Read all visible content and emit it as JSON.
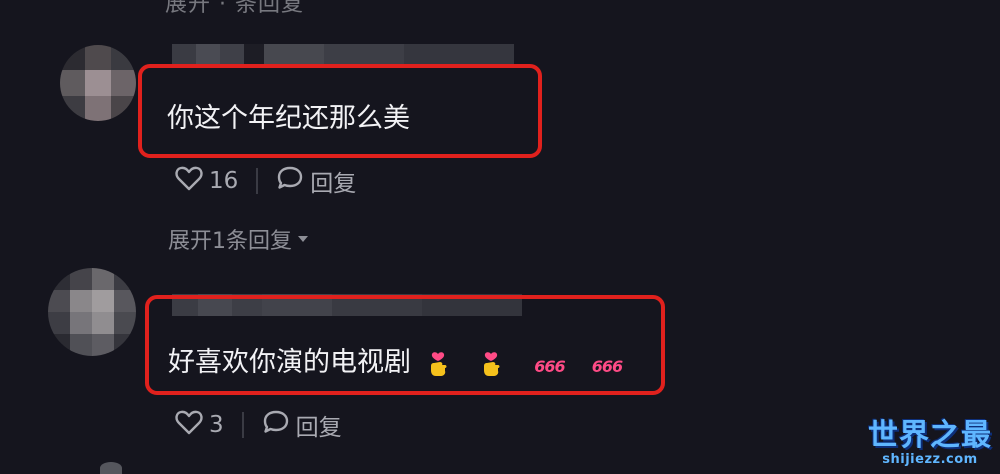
{
  "top_cut": "展开 · 条回复",
  "comments": [
    {
      "text": "你这个年纪还那么美",
      "likes": "16",
      "reply_label": "回复",
      "expand_label": "展开1条回复"
    },
    {
      "text": "好喜欢你演的电视剧",
      "emoji_number_1": "666",
      "emoji_number_2": "666",
      "likes": "3",
      "reply_label": "回复"
    }
  ],
  "watermark": {
    "main": "世界之最",
    "sub": "shijiezz.com"
  },
  "icons": [
    "heart-icon",
    "comment-bubble-icon",
    "chevron-down-icon",
    "heart-hands-emoji",
    "number-666-emoji"
  ],
  "colors": {
    "highlight": "#e0211d",
    "background": "#15151e",
    "watermark": "#5fb6ff"
  }
}
